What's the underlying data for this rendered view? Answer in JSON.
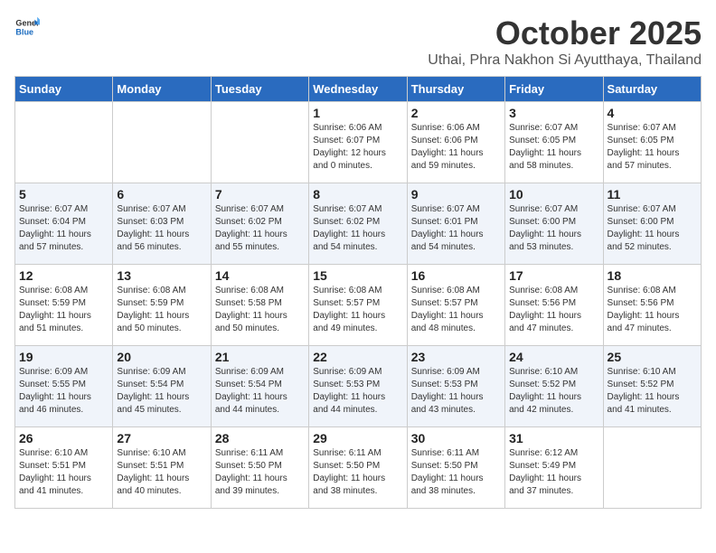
{
  "header": {
    "logo_general": "General",
    "logo_blue": "Blue",
    "month_title": "October 2025",
    "location": "Uthai, Phra Nakhon Si Ayutthaya, Thailand"
  },
  "days_of_week": [
    "Sunday",
    "Monday",
    "Tuesday",
    "Wednesday",
    "Thursday",
    "Friday",
    "Saturday"
  ],
  "weeks": [
    [
      {
        "day": "",
        "info": ""
      },
      {
        "day": "",
        "info": ""
      },
      {
        "day": "",
        "info": ""
      },
      {
        "day": "1",
        "info": "Sunrise: 6:06 AM\nSunset: 6:07 PM\nDaylight: 12 hours\nand 0 minutes."
      },
      {
        "day": "2",
        "info": "Sunrise: 6:06 AM\nSunset: 6:06 PM\nDaylight: 11 hours\nand 59 minutes."
      },
      {
        "day": "3",
        "info": "Sunrise: 6:07 AM\nSunset: 6:05 PM\nDaylight: 11 hours\nand 58 minutes."
      },
      {
        "day": "4",
        "info": "Sunrise: 6:07 AM\nSunset: 6:05 PM\nDaylight: 11 hours\nand 57 minutes."
      }
    ],
    [
      {
        "day": "5",
        "info": "Sunrise: 6:07 AM\nSunset: 6:04 PM\nDaylight: 11 hours\nand 57 minutes."
      },
      {
        "day": "6",
        "info": "Sunrise: 6:07 AM\nSunset: 6:03 PM\nDaylight: 11 hours\nand 56 minutes."
      },
      {
        "day": "7",
        "info": "Sunrise: 6:07 AM\nSunset: 6:02 PM\nDaylight: 11 hours\nand 55 minutes."
      },
      {
        "day": "8",
        "info": "Sunrise: 6:07 AM\nSunset: 6:02 PM\nDaylight: 11 hours\nand 54 minutes."
      },
      {
        "day": "9",
        "info": "Sunrise: 6:07 AM\nSunset: 6:01 PM\nDaylight: 11 hours\nand 54 minutes."
      },
      {
        "day": "10",
        "info": "Sunrise: 6:07 AM\nSunset: 6:00 PM\nDaylight: 11 hours\nand 53 minutes."
      },
      {
        "day": "11",
        "info": "Sunrise: 6:07 AM\nSunset: 6:00 PM\nDaylight: 11 hours\nand 52 minutes."
      }
    ],
    [
      {
        "day": "12",
        "info": "Sunrise: 6:08 AM\nSunset: 5:59 PM\nDaylight: 11 hours\nand 51 minutes."
      },
      {
        "day": "13",
        "info": "Sunrise: 6:08 AM\nSunset: 5:59 PM\nDaylight: 11 hours\nand 50 minutes."
      },
      {
        "day": "14",
        "info": "Sunrise: 6:08 AM\nSunset: 5:58 PM\nDaylight: 11 hours\nand 50 minutes."
      },
      {
        "day": "15",
        "info": "Sunrise: 6:08 AM\nSunset: 5:57 PM\nDaylight: 11 hours\nand 49 minutes."
      },
      {
        "day": "16",
        "info": "Sunrise: 6:08 AM\nSunset: 5:57 PM\nDaylight: 11 hours\nand 48 minutes."
      },
      {
        "day": "17",
        "info": "Sunrise: 6:08 AM\nSunset: 5:56 PM\nDaylight: 11 hours\nand 47 minutes."
      },
      {
        "day": "18",
        "info": "Sunrise: 6:08 AM\nSunset: 5:56 PM\nDaylight: 11 hours\nand 47 minutes."
      }
    ],
    [
      {
        "day": "19",
        "info": "Sunrise: 6:09 AM\nSunset: 5:55 PM\nDaylight: 11 hours\nand 46 minutes."
      },
      {
        "day": "20",
        "info": "Sunrise: 6:09 AM\nSunset: 5:54 PM\nDaylight: 11 hours\nand 45 minutes."
      },
      {
        "day": "21",
        "info": "Sunrise: 6:09 AM\nSunset: 5:54 PM\nDaylight: 11 hours\nand 44 minutes."
      },
      {
        "day": "22",
        "info": "Sunrise: 6:09 AM\nSunset: 5:53 PM\nDaylight: 11 hours\nand 44 minutes."
      },
      {
        "day": "23",
        "info": "Sunrise: 6:09 AM\nSunset: 5:53 PM\nDaylight: 11 hours\nand 43 minutes."
      },
      {
        "day": "24",
        "info": "Sunrise: 6:10 AM\nSunset: 5:52 PM\nDaylight: 11 hours\nand 42 minutes."
      },
      {
        "day": "25",
        "info": "Sunrise: 6:10 AM\nSunset: 5:52 PM\nDaylight: 11 hours\nand 41 minutes."
      }
    ],
    [
      {
        "day": "26",
        "info": "Sunrise: 6:10 AM\nSunset: 5:51 PM\nDaylight: 11 hours\nand 41 minutes."
      },
      {
        "day": "27",
        "info": "Sunrise: 6:10 AM\nSunset: 5:51 PM\nDaylight: 11 hours\nand 40 minutes."
      },
      {
        "day": "28",
        "info": "Sunrise: 6:11 AM\nSunset: 5:50 PM\nDaylight: 11 hours\nand 39 minutes."
      },
      {
        "day": "29",
        "info": "Sunrise: 6:11 AM\nSunset: 5:50 PM\nDaylight: 11 hours\nand 38 minutes."
      },
      {
        "day": "30",
        "info": "Sunrise: 6:11 AM\nSunset: 5:50 PM\nDaylight: 11 hours\nand 38 minutes."
      },
      {
        "day": "31",
        "info": "Sunrise: 6:12 AM\nSunset: 5:49 PM\nDaylight: 11 hours\nand 37 minutes."
      },
      {
        "day": "",
        "info": ""
      }
    ]
  ]
}
